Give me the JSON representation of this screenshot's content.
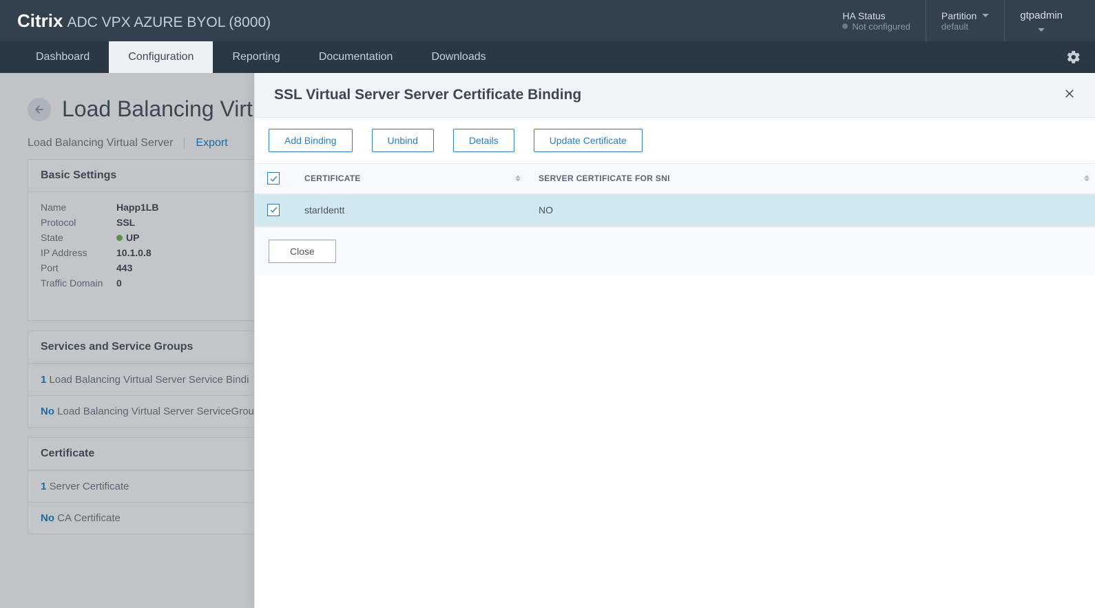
{
  "brand": {
    "main": "Citrix",
    "sub": "ADC VPX AZURE BYOL (8000)"
  },
  "topbar": {
    "ha_status_label": "HA Status",
    "ha_status_value": "Not configured",
    "partition_label": "Partition",
    "partition_value": "default",
    "user": "gtpadmin"
  },
  "nav": {
    "dashboard": "Dashboard",
    "configuration": "Configuration",
    "reporting": "Reporting",
    "documentation": "Documentation",
    "downloads": "Downloads"
  },
  "lb": {
    "title": "Load Balancing Virtual",
    "breadcrumb": "Load Balancing Virtual Server",
    "export": "Export",
    "basic_settings": "Basic Settings",
    "name_k": "Name",
    "name_v": "Happ1LB",
    "protocol_k": "Protocol",
    "protocol_v": "SSL",
    "state_k": "State",
    "state_v": "UP",
    "ip_k": "IP Address",
    "ip_v": "10.1.0.8",
    "port_k": "Port",
    "port_v": "443",
    "td_k": "Traffic Domain",
    "td_v": "0",
    "services_header": "Services and Service Groups",
    "row1_num": "1",
    "row1_text": " Load Balancing Virtual Server Service Bindi",
    "row2_no": "No",
    "row2_text": " Load Balancing Virtual Server ServiceGrou",
    "cert_header": "Certificate",
    "cert_row1_num": "1",
    "cert_row1_text": " Server Certificate",
    "cert_row2_no": "No",
    "cert_row2_text": " CA Certificate"
  },
  "panel": {
    "title": "SSL Virtual Server Server Certificate Binding",
    "add_binding": "Add Binding",
    "unbind": "Unbind",
    "details": "Details",
    "update_cert": "Update Certificate",
    "close": "Close",
    "col_cert": "CERTIFICATE",
    "col_sni": "SERVER CERTIFICATE FOR SNI",
    "rows": [
      {
        "certificate": "starIdentt",
        "sni": "NO"
      }
    ]
  }
}
